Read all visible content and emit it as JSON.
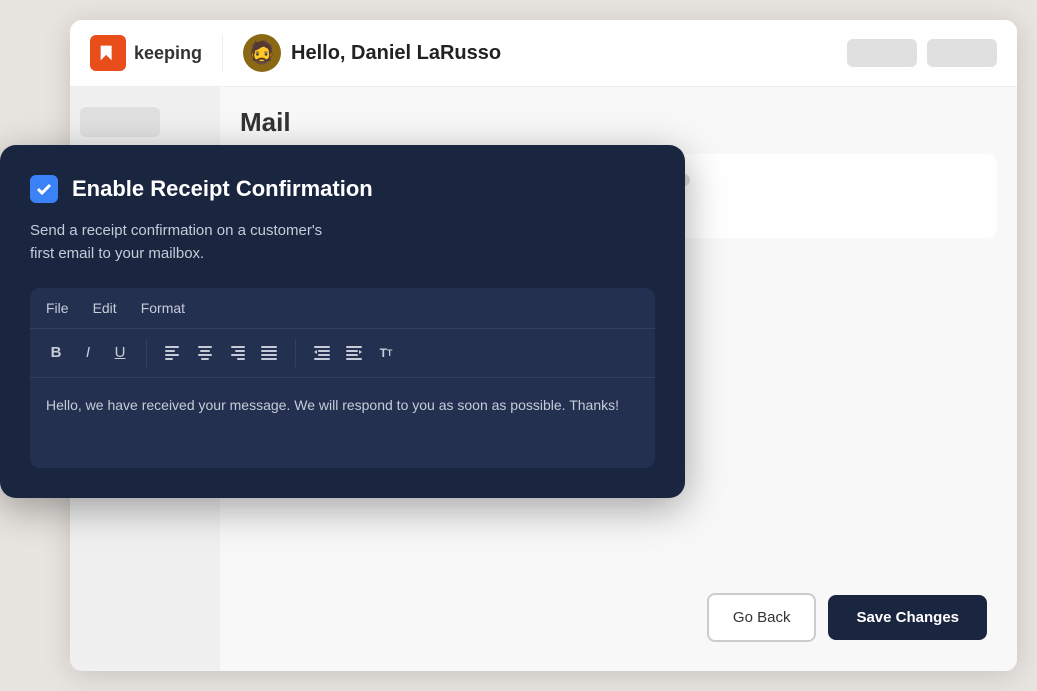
{
  "app": {
    "logo_text": "keeping",
    "user_greeting": "Hello, Daniel LaRusso",
    "avatar_emoji": "🧔",
    "content_title": "Mail"
  },
  "modal": {
    "title": "Enable Receipt Confirmation",
    "description": "Send a receipt confirmation on a customer's\nfirst email to your mailbox.",
    "checkbox_checked": true,
    "menubar": {
      "file": "File",
      "edit": "Edit",
      "format": "Format"
    },
    "toolbar": {
      "bold": "B",
      "italic": "I",
      "underline": "U"
    },
    "editor_content": "Hello, we have received your message. We will respond to you as soon as possible. Thanks!"
  },
  "buttons": {
    "go_back": "Go Back",
    "save_changes": "Save Changes"
  },
  "colors": {
    "accent_orange": "#e84d1a",
    "accent_blue": "#3b82f6",
    "modal_bg": "#1a2540",
    "save_btn_bg": "#1a2540"
  }
}
